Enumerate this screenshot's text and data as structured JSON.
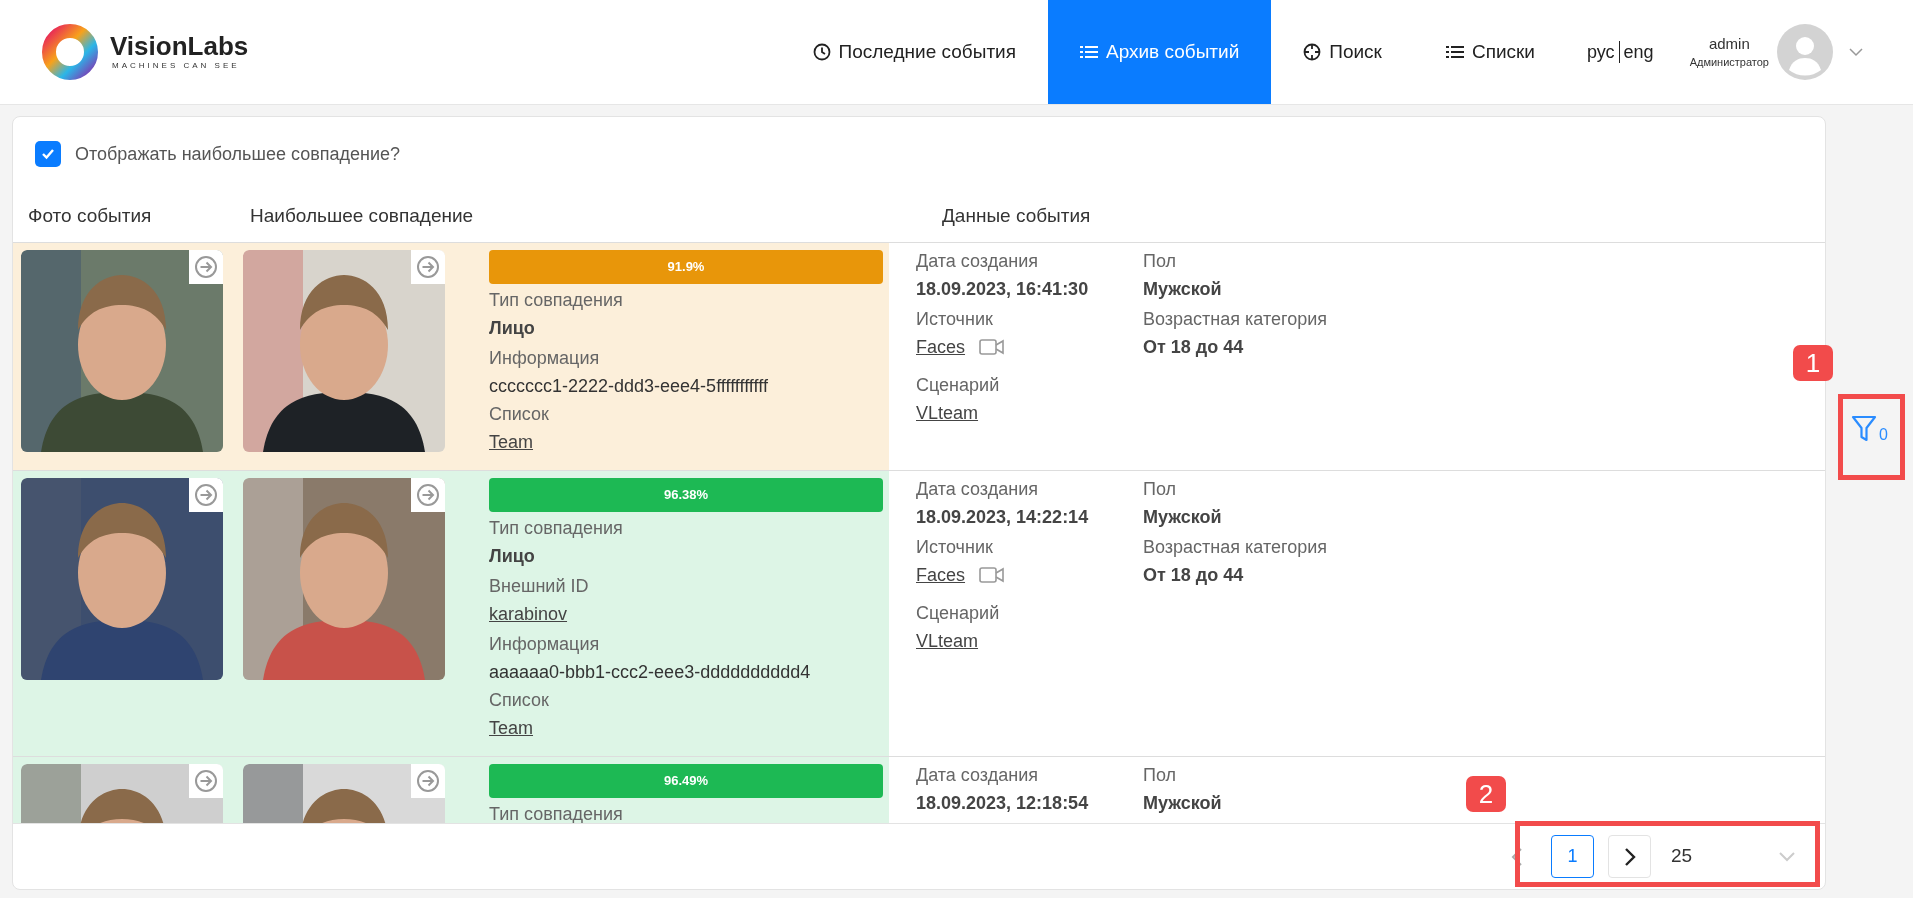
{
  "header": {
    "logo": {
      "name": "VisionLabs",
      "tagline": "MACHINES CAN SEE"
    },
    "nav": [
      {
        "label": "Последние события",
        "kind": "clock",
        "selected": false
      },
      {
        "label": "Архив событий",
        "kind": "list",
        "selected": true
      },
      {
        "label": "Поиск",
        "kind": "target",
        "selected": false
      },
      {
        "label": "Списки",
        "kind": "list",
        "selected": false
      }
    ],
    "languages": [
      "рус",
      "eng"
    ],
    "user": {
      "name": "admin",
      "role": "Администратор"
    }
  },
  "show_best_match": {
    "label": "Отображать наибольшее совпадение?",
    "checked": true
  },
  "columns": [
    "Фото события",
    "Наибольшее совпадение",
    "Данные события"
  ],
  "events": [
    {
      "color": "#e8960a",
      "score": "91.9%",
      "match_fields": [
        {
          "label": "Тип совпадения",
          "value": "Лицо",
          "kind": "text"
        },
        {
          "label": "Информация",
          "value": "ccccccc1-2222-ddd3-eee4-5fffffffffff",
          "kind": "plain"
        },
        {
          "label": "Список",
          "value": "Team",
          "kind": "link"
        }
      ],
      "data_left": [
        {
          "label": "Дата создания",
          "value": "18.09.2023, 16:41:30",
          "kind": "text"
        },
        {
          "label": "Источник",
          "value": "Faces",
          "kind": "source"
        },
        {
          "label": "Сценарий",
          "value": "VLteam",
          "kind": "link"
        }
      ],
      "data_right": [
        {
          "label": "Пол",
          "value": "Мужской",
          "kind": "text"
        },
        {
          "label": "Возрастная категория",
          "value": "От 18 до 44",
          "kind": "text"
        }
      ]
    },
    {
      "color": "#1db954",
      "score": "96.38%",
      "match_fields": [
        {
          "label": "Тип совпадения",
          "value": "Лицо",
          "kind": "text"
        },
        {
          "label": "Внешний ID",
          "value": "karabinov",
          "kind": "link"
        },
        {
          "label": "Информация",
          "value": "aaaaaa0-bbb1-ccc2-eee3-dddddddddd4",
          "kind": "plain"
        },
        {
          "label": "Список",
          "value": "Team",
          "kind": "link"
        }
      ],
      "data_left": [
        {
          "label": "Дата создания",
          "value": "18.09.2023, 14:22:14",
          "kind": "text"
        },
        {
          "label": "Источник",
          "value": "Faces",
          "kind": "source"
        },
        {
          "label": "Сценарий",
          "value": "VLteam",
          "kind": "link"
        }
      ],
      "data_right": [
        {
          "label": "Пол",
          "value": "Мужской",
          "kind": "text"
        },
        {
          "label": "Возрастная категория",
          "value": "От 18 до 44",
          "kind": "text"
        }
      ]
    },
    {
      "color": "#1db954",
      "score": "96.49%",
      "match_fields": [
        {
          "label": "Тип совпадения",
          "kind": "label"
        }
      ],
      "data_left": [
        {
          "label": "Дата создания",
          "value": "18.09.2023, 12:18:54",
          "kind": "text"
        }
      ],
      "data_right": [
        {
          "label": "Пол",
          "value": "Мужской",
          "kind": "text"
        }
      ]
    }
  ],
  "filter": {
    "count": "0"
  },
  "pagination": {
    "current": "1",
    "page_size": "25"
  },
  "annotations": [
    {
      "label": "1"
    },
    {
      "label": "2"
    }
  ]
}
